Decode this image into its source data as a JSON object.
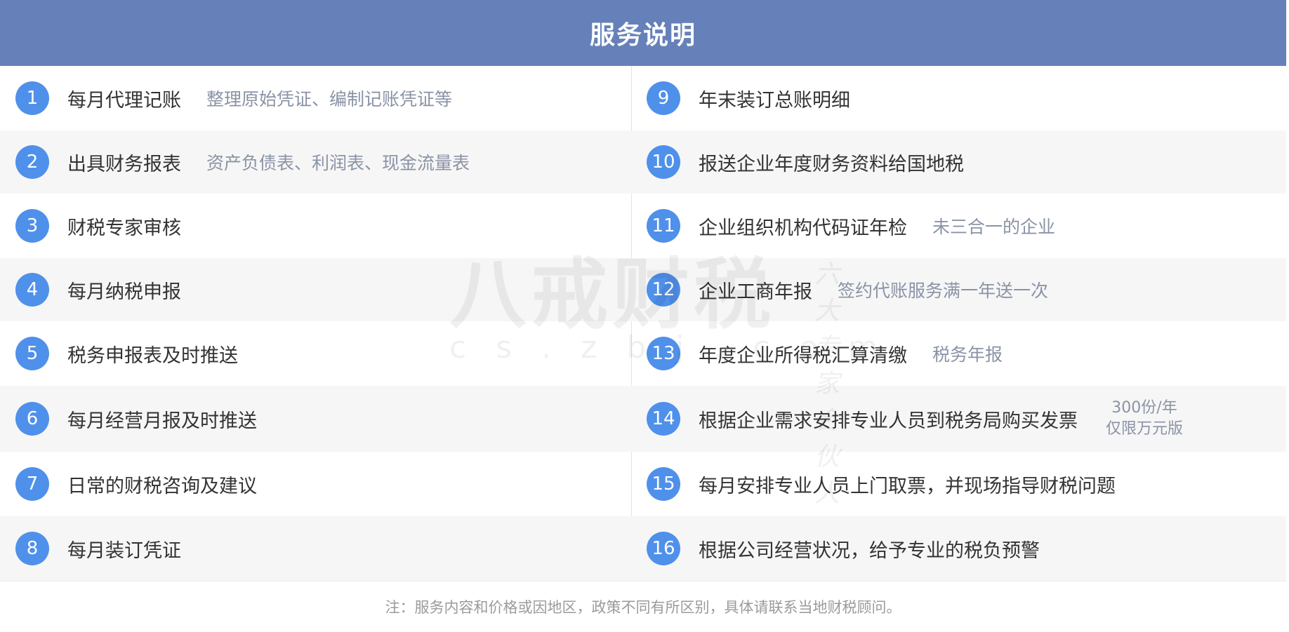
{
  "header": {
    "title": "服务说明"
  },
  "left_items": [
    {
      "num": "1",
      "title": "每月代理记账",
      "note": "整理原始凭证、编制记账凭证等"
    },
    {
      "num": "2",
      "title": "出具财务报表",
      "note": "资产负债表、利润表、现金流量表"
    },
    {
      "num": "3",
      "title": "财税专家审核",
      "note": ""
    },
    {
      "num": "4",
      "title": "每月纳税申报",
      "note": ""
    },
    {
      "num": "5",
      "title": "税务申报表及时推送",
      "note": ""
    },
    {
      "num": "6",
      "title": "每月经营月报及时推送",
      "note": ""
    },
    {
      "num": "7",
      "title": "日常的财税咨询及建议",
      "note": ""
    },
    {
      "num": "8",
      "title": "每月装订凭证",
      "note": ""
    }
  ],
  "right_items": [
    {
      "num": "9",
      "title": "年末装订总账明细",
      "note": ""
    },
    {
      "num": "10",
      "title": "报送企业年度财务资料给国地税",
      "note": ""
    },
    {
      "num": "11",
      "title": "企业组织机构代码证年检",
      "note": "未三合一的企业"
    },
    {
      "num": "12",
      "title": "企业工商年报",
      "note": "签约代账服务满一年送一次"
    },
    {
      "num": "13",
      "title": "年度企业所得税汇算清缴",
      "note": "税务年报"
    },
    {
      "num": "14",
      "title": "根据企业需求安排专业人员到税务局购买发票",
      "note_line1": "300份/年",
      "note_line2": "仅限万元版"
    },
    {
      "num": "15",
      "title": "每月安排专业人员上门取票，并现场指导财税问题",
      "note": ""
    },
    {
      "num": "16",
      "title": "根据公司经营状况，给予专业的税负预警",
      "note": ""
    }
  ],
  "footer": {
    "text": "注：服务内容和价格或因地区，政策不同有所区别，具体请联系当地财税顾问。"
  },
  "watermark": {
    "brand": "八戒财税",
    "url": "cs.zbj.com",
    "slogan": "六大专家合伙人"
  },
  "colors": {
    "header": "#6681b9",
    "badge": "#4f90ea",
    "alt_row": "#f6f6f6"
  }
}
